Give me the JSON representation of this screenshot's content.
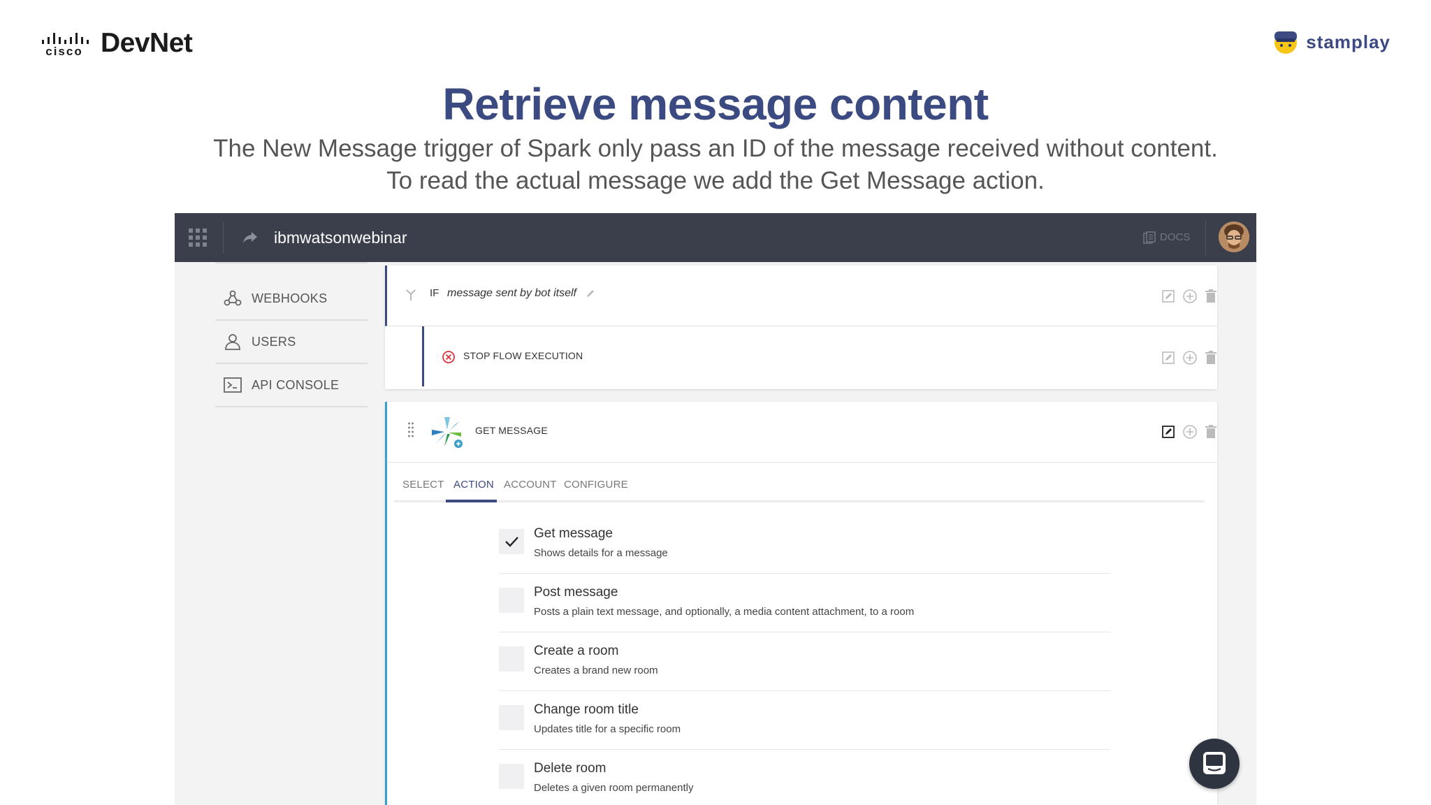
{
  "branding": {
    "cisco_mark": "cisco",
    "cisco_product": "DevNet",
    "stamplay_name": "stamplay"
  },
  "slide": {
    "title": "Retrieve message content",
    "subtitle": "The New Message trigger of Spark only pass an ID of the message received without content. To read the actual message we add the Get Message action."
  },
  "app": {
    "name": "ibmwatsonwebinar",
    "docs_label": "DOCS",
    "icons": {
      "menu": "grid-icon",
      "share": "share-arrow-icon",
      "docs": "docs-icon",
      "avatar": "user-avatar"
    }
  },
  "sidebar": {
    "items": [
      {
        "label": "WEBHOOKS",
        "icon": "webhooks-icon"
      },
      {
        "label": "USERS",
        "icon": "user-icon"
      },
      {
        "label": "API CONSOLE",
        "icon": "console-icon"
      }
    ]
  },
  "flow": {
    "if_row": {
      "keyword": "IF",
      "condition": "message sent by bot itself"
    },
    "stop_row": {
      "label": "STOP FLOW EXECUTION"
    },
    "get_card": {
      "title": "GET MESSAGE",
      "tabs": [
        "SELECT",
        "ACTION",
        "ACCOUNT",
        "CONFIGURE"
      ],
      "active_tab": "ACTION",
      "options": [
        {
          "title": "Get message",
          "description": "Shows details for a message",
          "checked": true
        },
        {
          "title": "Post message",
          "description": "Posts a plain text message, and optionally, a media content attachment, to a room",
          "checked": false
        },
        {
          "title": "Create a room",
          "description": "Creates a brand new room",
          "checked": false
        },
        {
          "title": "Change room title",
          "description": "Updates title for a specific room",
          "checked": false
        },
        {
          "title": "Delete room",
          "description": "Deletes a given room permanently",
          "checked": false
        }
      ]
    }
  },
  "colors": {
    "brand": "#3c4a82",
    "topbar": "#3a3f4b",
    "accent": "#3aa0c8",
    "stop": "#d9343b"
  }
}
